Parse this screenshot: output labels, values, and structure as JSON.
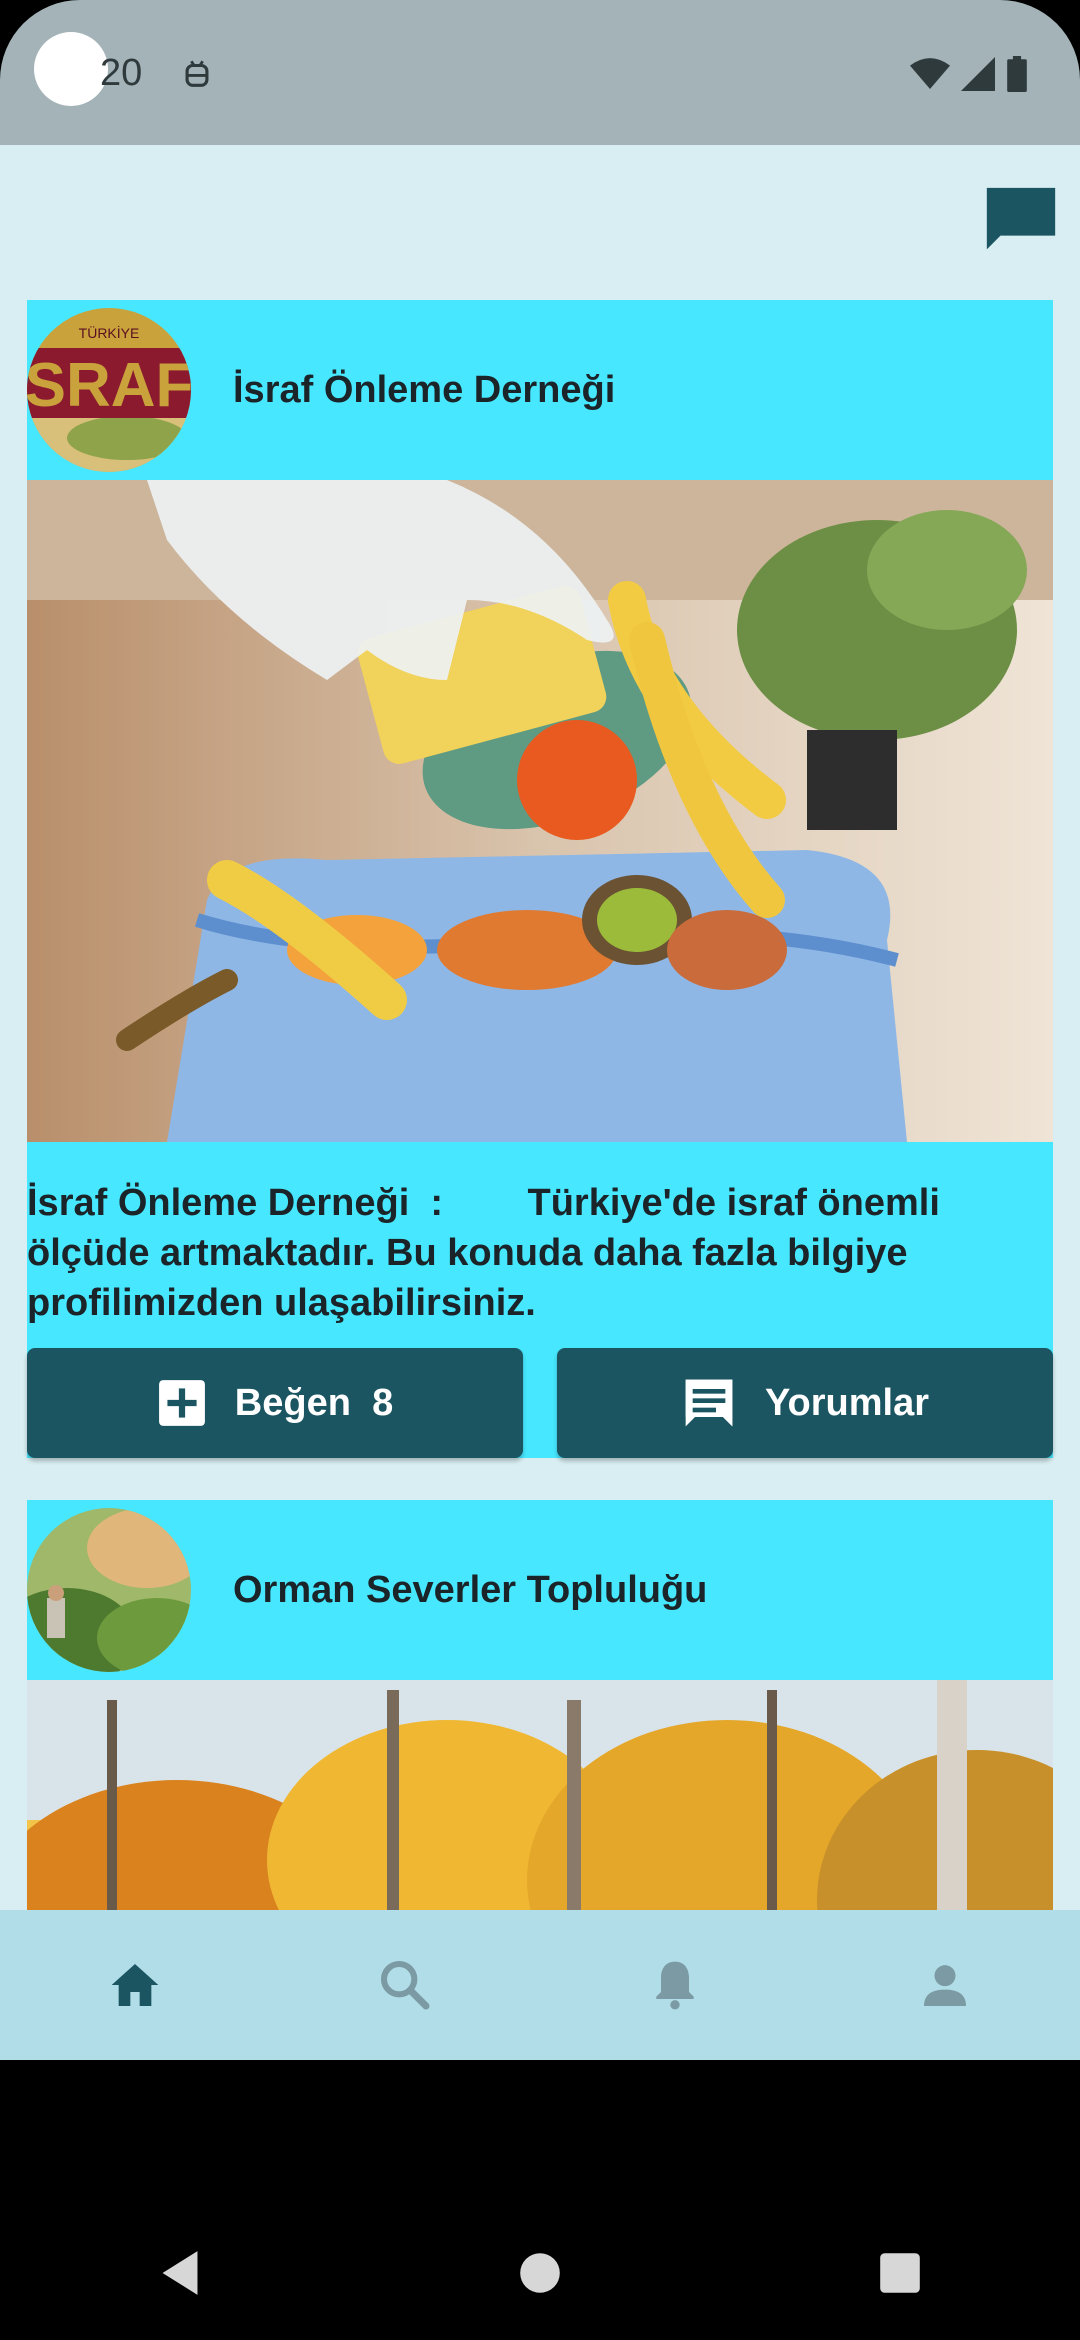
{
  "status_bar": {
    "time": "20"
  },
  "colors": {
    "status_bar_bg": "#a3b3b8",
    "app_bg": "#d8eef2",
    "card_bg": "#47e8ff",
    "button_bg": "#1c5562",
    "bottom_nav_bg": "#b0dde7",
    "nav_active": "#1c5562",
    "nav_inactive": "#7b9aa3"
  },
  "header": {
    "chat_icon": "chat-bubble-icon"
  },
  "posts": [
    {
      "author": "İsraf Önleme Derneği",
      "avatar_icon": "israf-logo",
      "image_description_icon": "food-waste-photo",
      "text": "İsraf Önleme Derneği  :        Türkiye'de israf önemli ölçüde artmaktadır. Bu konuda daha fazla bilgiye profilimizden ulaşabilirsiniz.",
      "like_label": "Beğen",
      "like_count": "8",
      "comments_label": "Yorumlar"
    },
    {
      "author": "Orman Severler Topluluğu",
      "avatar_icon": "forest-avatar",
      "image_description_icon": "autumn-forest-photo"
    }
  ],
  "bottom_nav": {
    "items": [
      {
        "icon": "home-icon",
        "active": true
      },
      {
        "icon": "search-icon",
        "active": false
      },
      {
        "icon": "bell-icon",
        "active": false
      },
      {
        "icon": "person-icon",
        "active": false
      }
    ]
  },
  "system_nav": {
    "items": [
      "back-icon",
      "home-circle-icon",
      "recents-icon"
    ]
  }
}
